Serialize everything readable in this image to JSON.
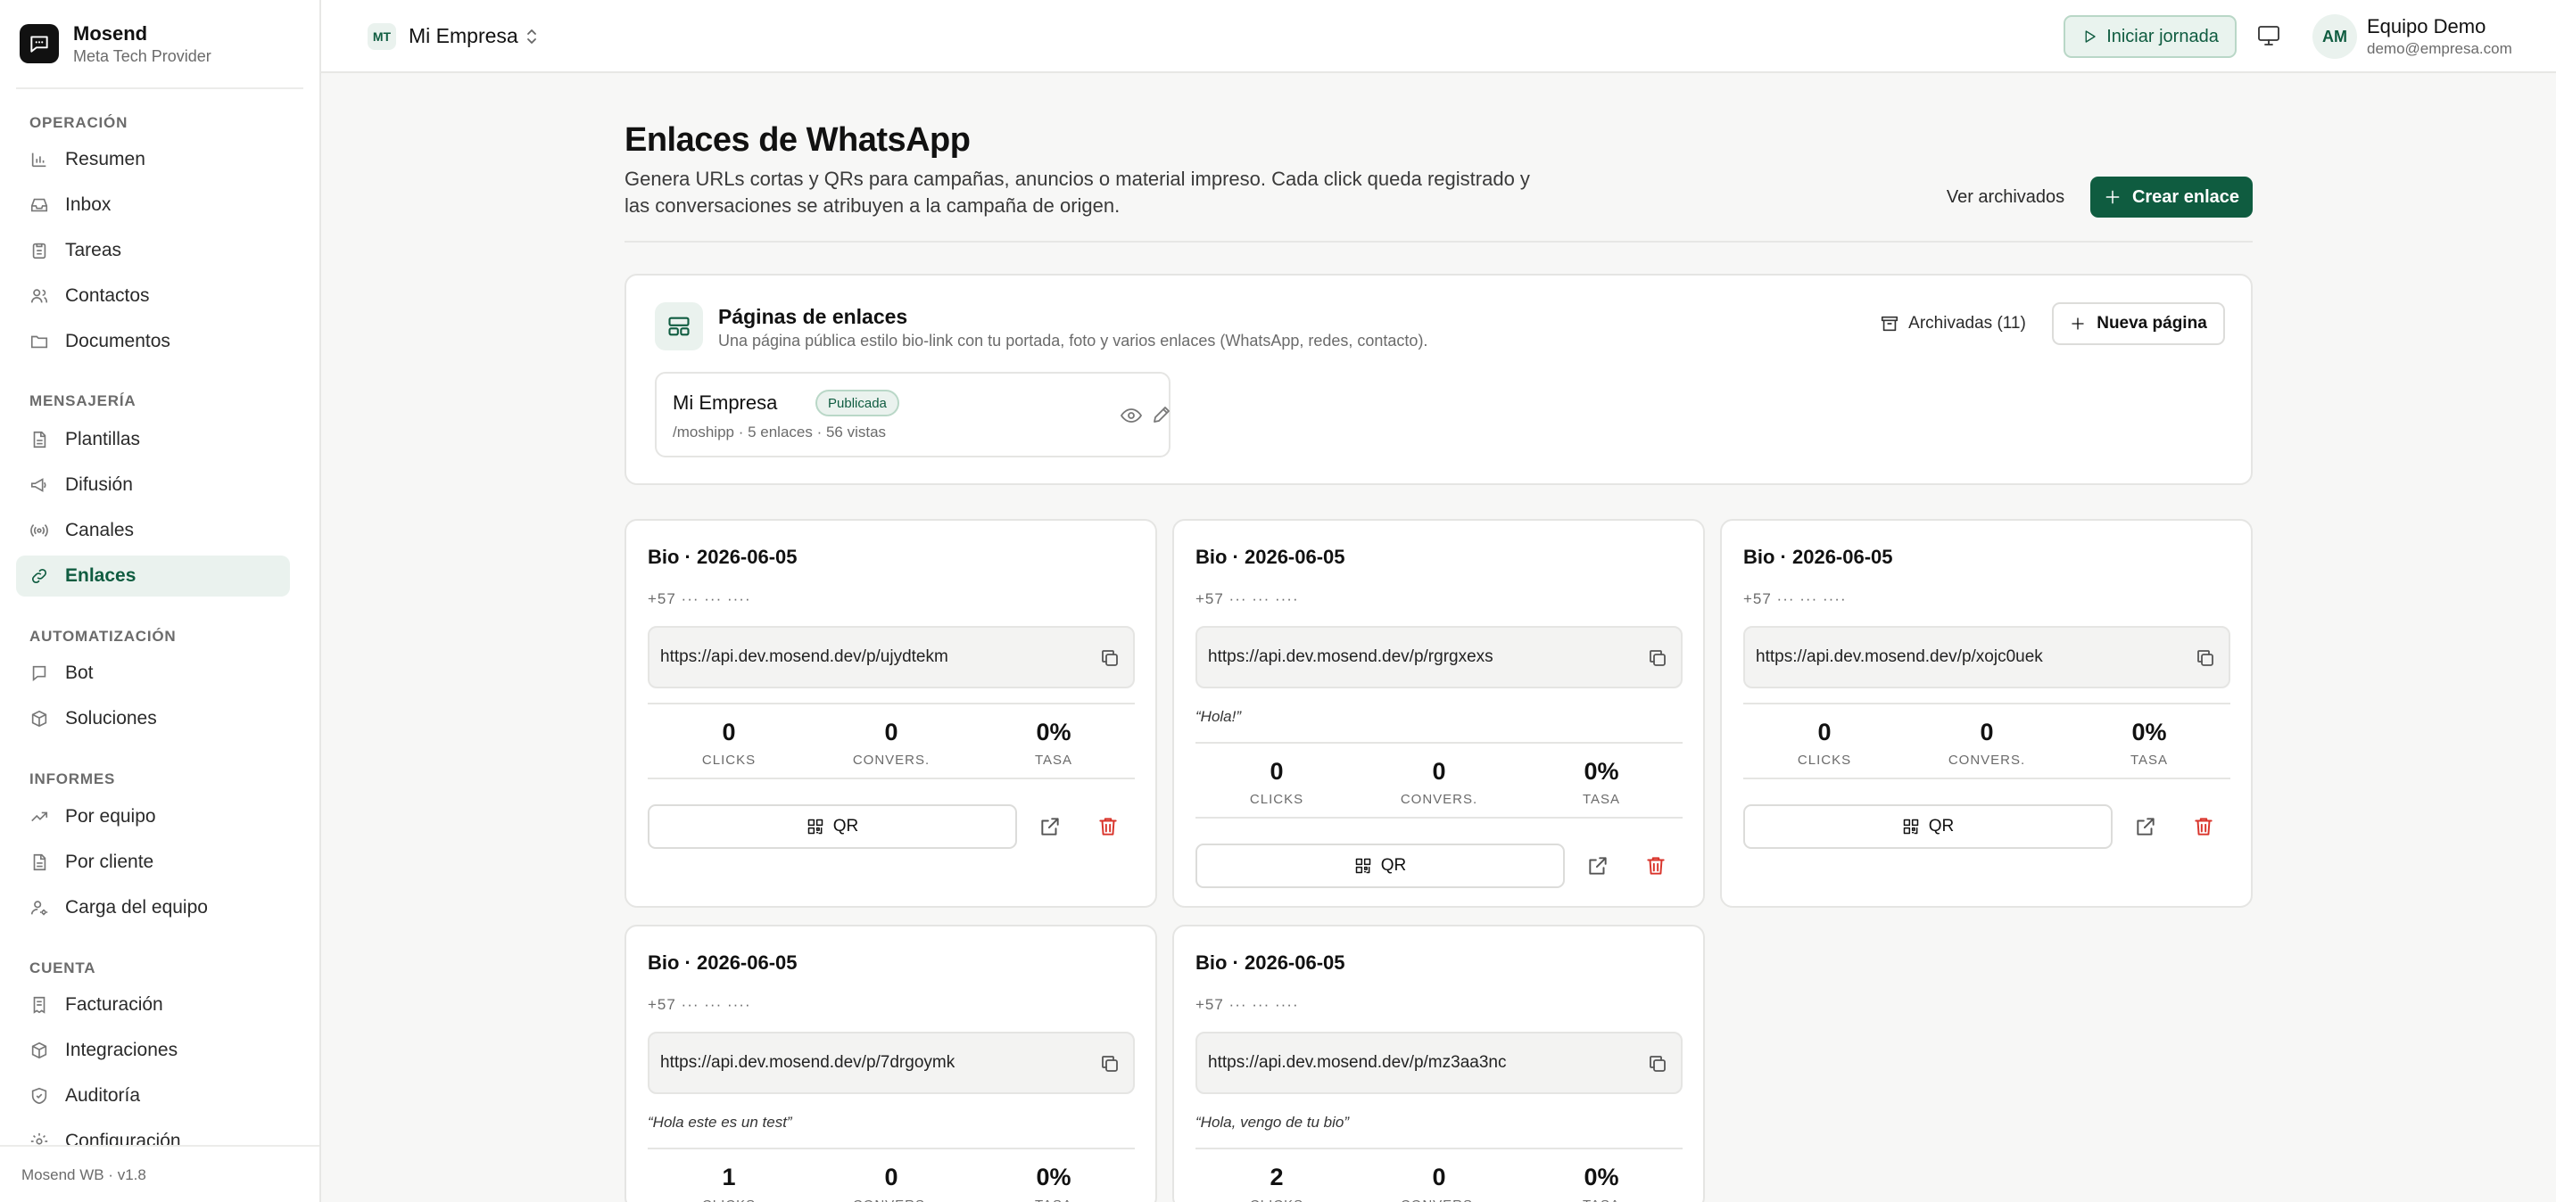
{
  "brand": {
    "name": "Mosend",
    "subtitle": "Meta Tech Provider",
    "version": "Mosend WB · v1.8"
  },
  "sidebar": {
    "sections": [
      {
        "label": "Operación",
        "items": [
          {
            "label": "Resumen",
            "icon": "bar-chart-icon"
          },
          {
            "label": "Inbox",
            "icon": "inbox-icon"
          },
          {
            "label": "Tareas",
            "icon": "clipboard-icon"
          },
          {
            "label": "Contactos",
            "icon": "users-icon"
          },
          {
            "label": "Documentos",
            "icon": "folder-icon"
          }
        ]
      },
      {
        "label": "Mensajería",
        "items": [
          {
            "label": "Plantillas",
            "icon": "file-icon"
          },
          {
            "label": "Difusión",
            "icon": "megaphone-icon"
          },
          {
            "label": "Canales",
            "icon": "radio-icon"
          },
          {
            "label": "Enlaces",
            "icon": "link-icon",
            "active": true
          }
        ]
      },
      {
        "label": "Automatización",
        "items": [
          {
            "label": "Bot",
            "icon": "bot-icon"
          },
          {
            "label": "Soluciones",
            "icon": "box-icon"
          }
        ]
      },
      {
        "label": "Informes",
        "items": [
          {
            "label": "Por equipo",
            "icon": "trending-icon"
          },
          {
            "label": "Por cliente",
            "icon": "file-icon"
          },
          {
            "label": "Carga del equipo",
            "icon": "user-gear-icon"
          }
        ]
      },
      {
        "label": "Cuenta",
        "items": [
          {
            "label": "Facturación",
            "icon": "receipt-icon"
          },
          {
            "label": "Integraciones",
            "icon": "plug-icon"
          },
          {
            "label": "Auditoría",
            "icon": "shield-icon"
          },
          {
            "label": "Configuración",
            "icon": "gear-icon"
          }
        ]
      }
    ]
  },
  "topbar": {
    "workspace_initials": "MT",
    "workspace_name": "Mi Empresa",
    "start_day_label": "Iniciar jornada",
    "user_initials": "AM",
    "user_name": "Equipo Demo",
    "user_email": "demo@empresa.com"
  },
  "header": {
    "title": "Enlaces de WhatsApp",
    "description": "Genera URLs cortas y QRs para campañas, anuncios o material impreso. Cada click queda registrado y las conversaciones se atribuyen a la campaña de origen.",
    "archived_label": "Ver archivados",
    "create_label": "Crear enlace"
  },
  "pages_panel": {
    "title": "Páginas de enlaces",
    "subtitle": "Una página pública estilo bio-link con tu portada, foto y varios enlaces (WhatsApp, redes, contacto).",
    "archived_label": "Archivadas (11)",
    "new_label": "Nueva página",
    "page": {
      "name": "Mi Empresa",
      "status": "Publicada",
      "meta": "/moshipp · 5 enlaces · 56 vistas"
    }
  },
  "stat_labels": {
    "clicks": "CLICKS",
    "convers": "CONVERS.",
    "rate": "TASA"
  },
  "qr_label": "QR",
  "links": [
    {
      "title": "Bio · 2026-06-05",
      "phone": "+57 ··· ··· ····",
      "url": "https://api.dev.mosend.dev/p/ujydtekm",
      "quote": "",
      "clicks": "0",
      "convers": "0",
      "rate": "0%"
    },
    {
      "title": "Bio · 2026-06-05",
      "phone": "+57 ··· ··· ····",
      "url": "https://api.dev.mosend.dev/p/rgrgxexs",
      "quote": "“Hola!”",
      "clicks": "0",
      "convers": "0",
      "rate": "0%"
    },
    {
      "title": "Bio · 2026-06-05",
      "phone": "+57 ··· ··· ····",
      "url": "https://api.dev.mosend.dev/p/xojc0uek",
      "quote": "",
      "clicks": "0",
      "convers": "0",
      "rate": "0%"
    },
    {
      "title": "Bio · 2026-06-05",
      "phone": "+57 ··· ··· ····",
      "url": "https://api.dev.mosend.dev/p/7drgoymk",
      "quote": "“Hola este es un test”",
      "clicks": "1",
      "convers": "0",
      "rate": "0%"
    },
    {
      "title": "Bio · 2026-06-05",
      "phone": "+57 ··· ··· ····",
      "url": "https://api.dev.mosend.dev/p/mz3aa3nc",
      "quote": "“Hola, vengo de tu bio”",
      "clicks": "2",
      "convers": "0",
      "rate": "0%"
    }
  ],
  "colors": {
    "accent": "#0f5c40",
    "accent_soft": "#eaf2ee",
    "danger": "#d9342b"
  }
}
